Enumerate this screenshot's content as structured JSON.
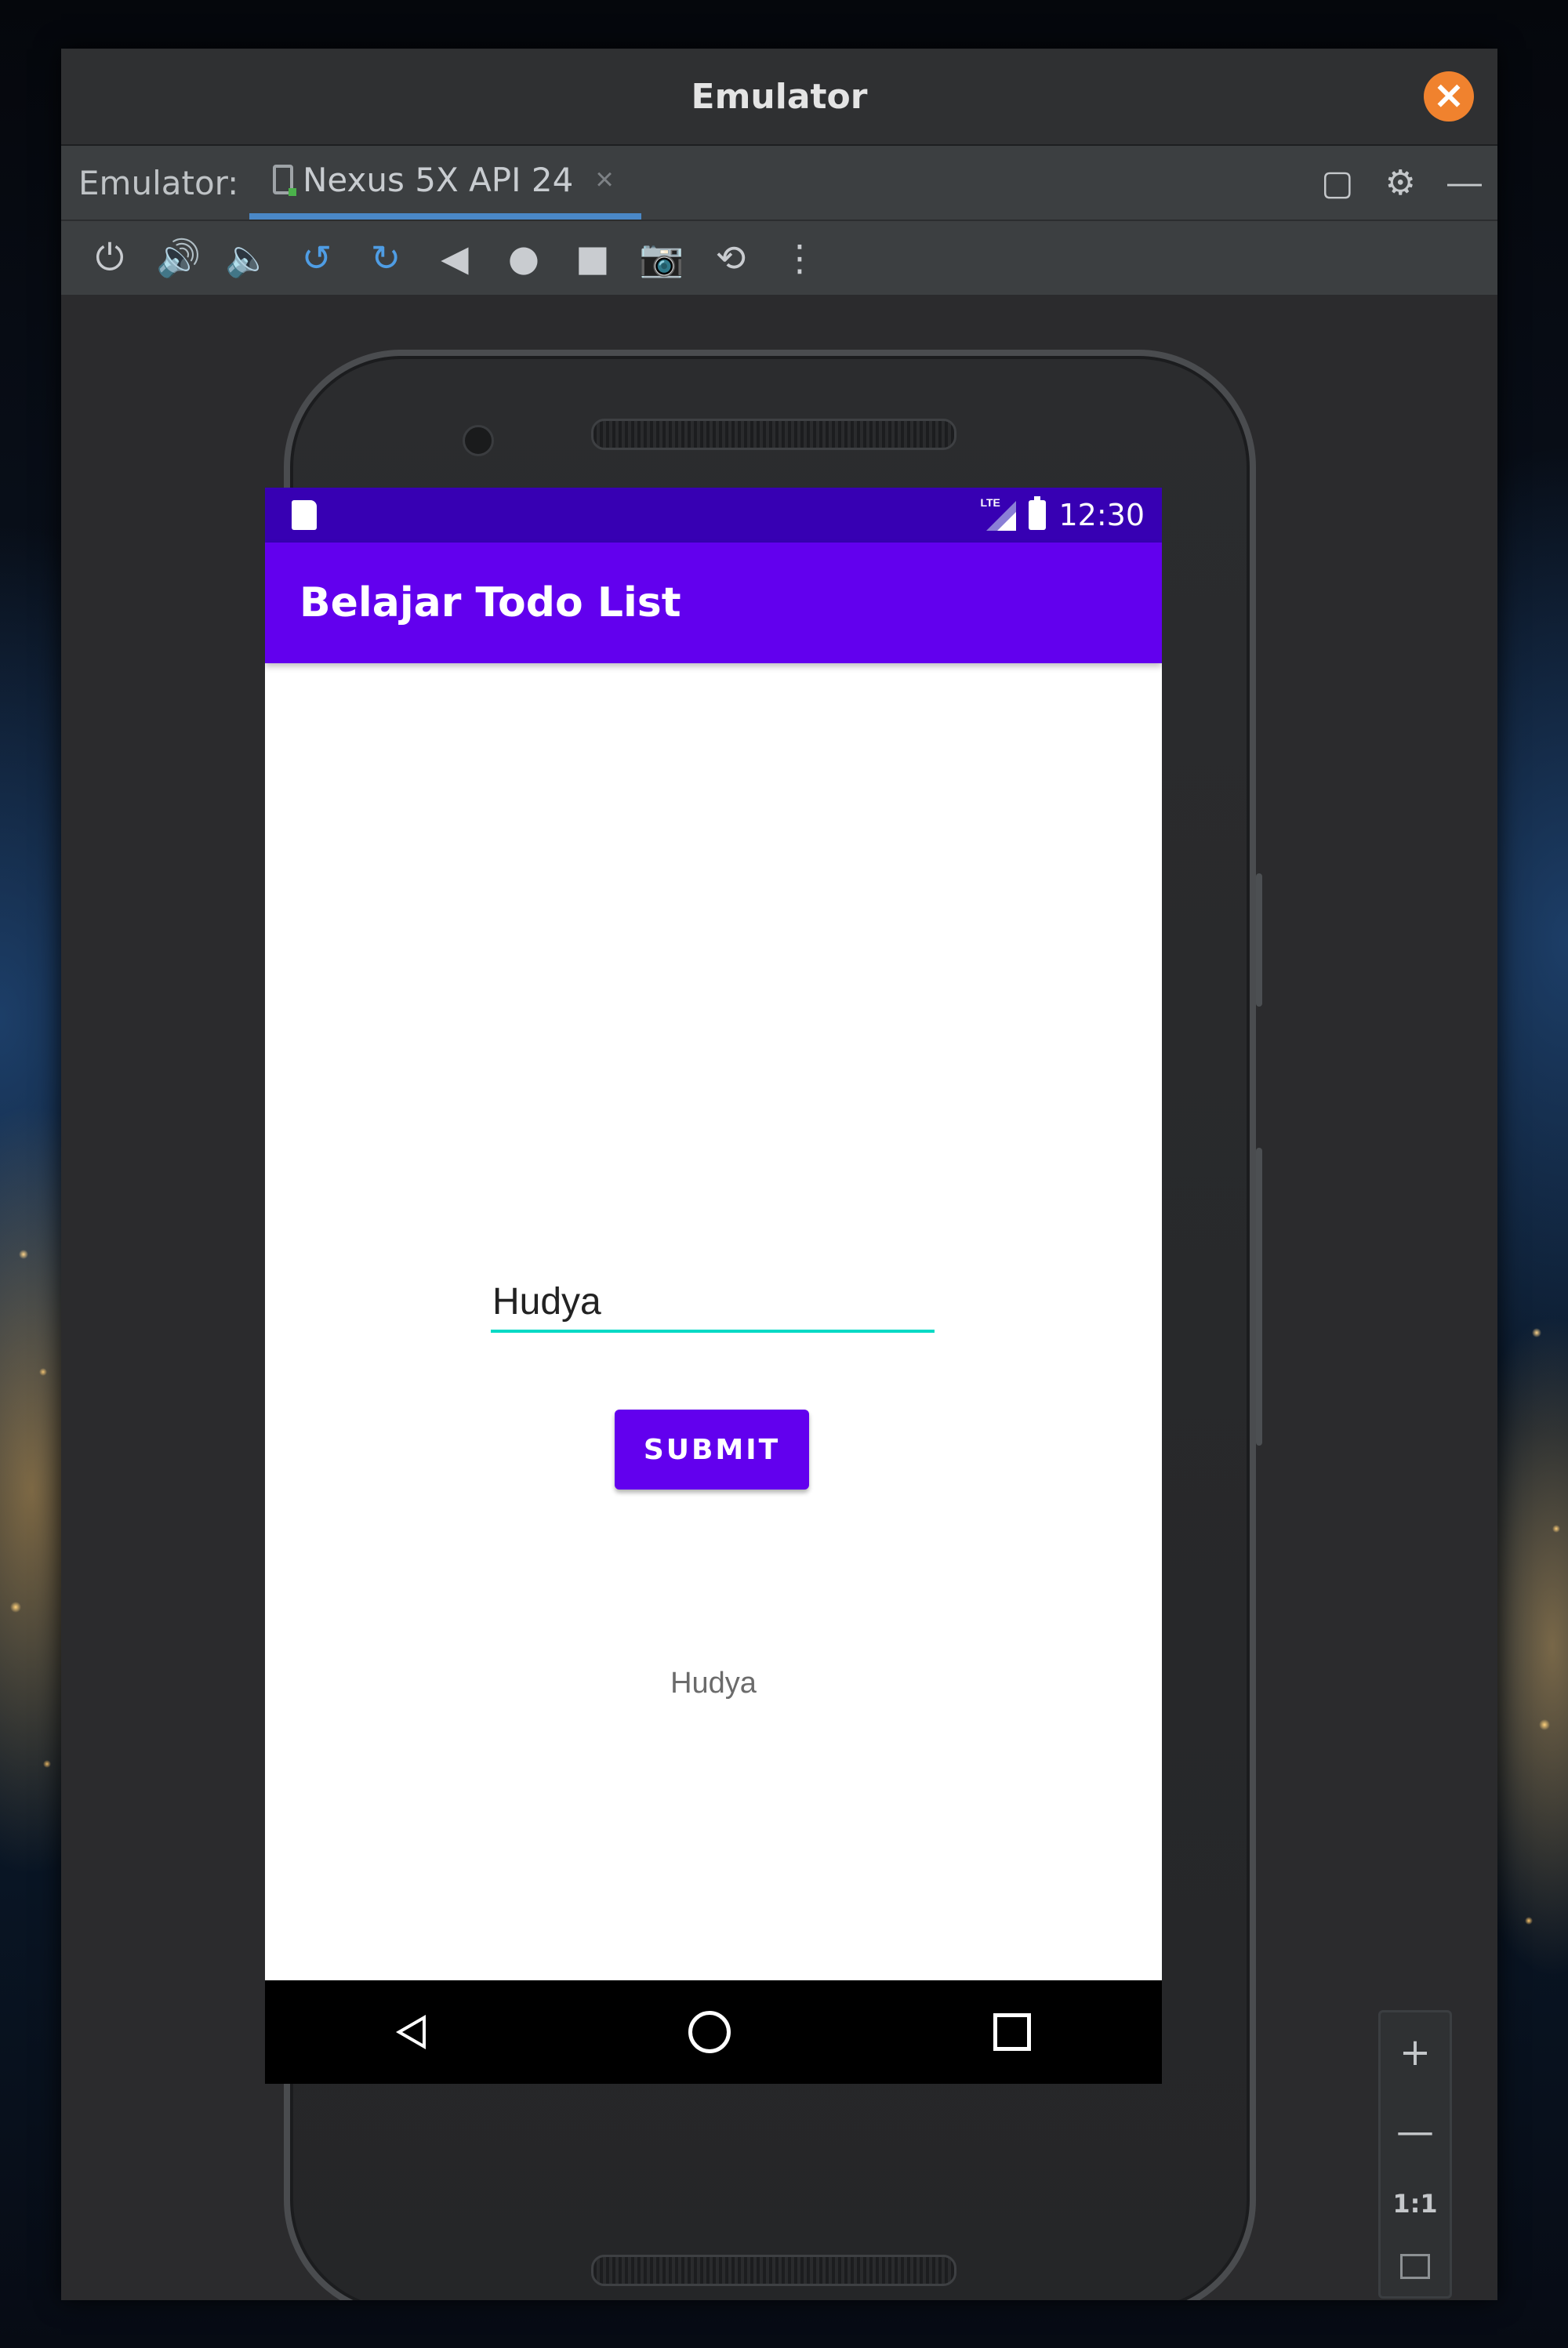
{
  "window": {
    "title": "Emulator",
    "close_icon": "close-icon",
    "close_glyph": "✕"
  },
  "tabbar": {
    "prefix": "Emulator:",
    "device_tab_label": "Nexus 5X API 24",
    "tab_close_glyph": "×",
    "right_icons": [
      "restore-icon",
      "gear-icon",
      "minimize-icon"
    ],
    "right_glyphs": [
      "▢",
      "⚙",
      "—"
    ]
  },
  "toolbar": {
    "tools": [
      {
        "name": "power-icon",
        "glyph": "⏻"
      },
      {
        "name": "volume-up-icon",
        "glyph": "🔊"
      },
      {
        "name": "volume-down-icon",
        "glyph": "🔈"
      },
      {
        "name": "rotate-left-icon",
        "glyph": "↺"
      },
      {
        "name": "rotate-right-icon",
        "glyph": "↻"
      },
      {
        "name": "back-icon",
        "glyph": "◀"
      },
      {
        "name": "home-icon",
        "glyph": "●"
      },
      {
        "name": "overview-icon",
        "glyph": "■"
      },
      {
        "name": "camera-icon",
        "glyph": "📷"
      },
      {
        "name": "snapshot-icon",
        "glyph": "⟲"
      },
      {
        "name": "more-icon",
        "glyph": "⋮"
      }
    ]
  },
  "device": {
    "status_bar": {
      "time": "12:30",
      "network": "LTE",
      "accent": "#3700b3"
    },
    "app": {
      "title": "Belajar Todo List",
      "primary_color": "#6200ee",
      "input_value": "Hudya",
      "submit_label": "SUBMIT",
      "result_text": "Hudya"
    }
  },
  "zoom": {
    "zoom_in": "+",
    "zoom_out": "—",
    "actual_size": "1:1",
    "fit_icon": "fit-screen-icon"
  }
}
